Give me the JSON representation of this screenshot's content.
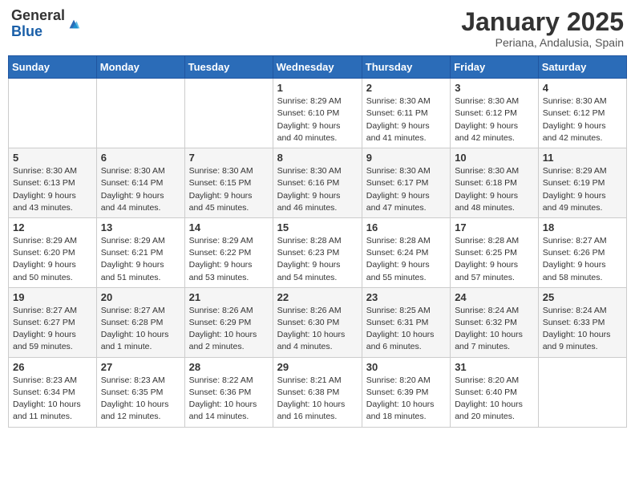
{
  "logo": {
    "general": "General",
    "blue": "Blue"
  },
  "title": "January 2025",
  "subtitle": "Periana, Andalusia, Spain",
  "days_of_week": [
    "Sunday",
    "Monday",
    "Tuesday",
    "Wednesday",
    "Thursday",
    "Friday",
    "Saturday"
  ],
  "weeks": [
    [
      {
        "day": "",
        "info": ""
      },
      {
        "day": "",
        "info": ""
      },
      {
        "day": "",
        "info": ""
      },
      {
        "day": "1",
        "info": "Sunrise: 8:29 AM\nSunset: 6:10 PM\nDaylight: 9 hours\nand 40 minutes."
      },
      {
        "day": "2",
        "info": "Sunrise: 8:30 AM\nSunset: 6:11 PM\nDaylight: 9 hours\nand 41 minutes."
      },
      {
        "day": "3",
        "info": "Sunrise: 8:30 AM\nSunset: 6:12 PM\nDaylight: 9 hours\nand 42 minutes."
      },
      {
        "day": "4",
        "info": "Sunrise: 8:30 AM\nSunset: 6:12 PM\nDaylight: 9 hours\nand 42 minutes."
      }
    ],
    [
      {
        "day": "5",
        "info": "Sunrise: 8:30 AM\nSunset: 6:13 PM\nDaylight: 9 hours\nand 43 minutes."
      },
      {
        "day": "6",
        "info": "Sunrise: 8:30 AM\nSunset: 6:14 PM\nDaylight: 9 hours\nand 44 minutes."
      },
      {
        "day": "7",
        "info": "Sunrise: 8:30 AM\nSunset: 6:15 PM\nDaylight: 9 hours\nand 45 minutes."
      },
      {
        "day": "8",
        "info": "Sunrise: 8:30 AM\nSunset: 6:16 PM\nDaylight: 9 hours\nand 46 minutes."
      },
      {
        "day": "9",
        "info": "Sunrise: 8:30 AM\nSunset: 6:17 PM\nDaylight: 9 hours\nand 47 minutes."
      },
      {
        "day": "10",
        "info": "Sunrise: 8:30 AM\nSunset: 6:18 PM\nDaylight: 9 hours\nand 48 minutes."
      },
      {
        "day": "11",
        "info": "Sunrise: 8:29 AM\nSunset: 6:19 PM\nDaylight: 9 hours\nand 49 minutes."
      }
    ],
    [
      {
        "day": "12",
        "info": "Sunrise: 8:29 AM\nSunset: 6:20 PM\nDaylight: 9 hours\nand 50 minutes."
      },
      {
        "day": "13",
        "info": "Sunrise: 8:29 AM\nSunset: 6:21 PM\nDaylight: 9 hours\nand 51 minutes."
      },
      {
        "day": "14",
        "info": "Sunrise: 8:29 AM\nSunset: 6:22 PM\nDaylight: 9 hours\nand 53 minutes."
      },
      {
        "day": "15",
        "info": "Sunrise: 8:28 AM\nSunset: 6:23 PM\nDaylight: 9 hours\nand 54 minutes."
      },
      {
        "day": "16",
        "info": "Sunrise: 8:28 AM\nSunset: 6:24 PM\nDaylight: 9 hours\nand 55 minutes."
      },
      {
        "day": "17",
        "info": "Sunrise: 8:28 AM\nSunset: 6:25 PM\nDaylight: 9 hours\nand 57 minutes."
      },
      {
        "day": "18",
        "info": "Sunrise: 8:27 AM\nSunset: 6:26 PM\nDaylight: 9 hours\nand 58 minutes."
      }
    ],
    [
      {
        "day": "19",
        "info": "Sunrise: 8:27 AM\nSunset: 6:27 PM\nDaylight: 9 hours\nand 59 minutes."
      },
      {
        "day": "20",
        "info": "Sunrise: 8:27 AM\nSunset: 6:28 PM\nDaylight: 10 hours\nand 1 minute."
      },
      {
        "day": "21",
        "info": "Sunrise: 8:26 AM\nSunset: 6:29 PM\nDaylight: 10 hours\nand 2 minutes."
      },
      {
        "day": "22",
        "info": "Sunrise: 8:26 AM\nSunset: 6:30 PM\nDaylight: 10 hours\nand 4 minutes."
      },
      {
        "day": "23",
        "info": "Sunrise: 8:25 AM\nSunset: 6:31 PM\nDaylight: 10 hours\nand 6 minutes."
      },
      {
        "day": "24",
        "info": "Sunrise: 8:24 AM\nSunset: 6:32 PM\nDaylight: 10 hours\nand 7 minutes."
      },
      {
        "day": "25",
        "info": "Sunrise: 8:24 AM\nSunset: 6:33 PM\nDaylight: 10 hours\nand 9 minutes."
      }
    ],
    [
      {
        "day": "26",
        "info": "Sunrise: 8:23 AM\nSunset: 6:34 PM\nDaylight: 10 hours\nand 11 minutes."
      },
      {
        "day": "27",
        "info": "Sunrise: 8:23 AM\nSunset: 6:35 PM\nDaylight: 10 hours\nand 12 minutes."
      },
      {
        "day": "28",
        "info": "Sunrise: 8:22 AM\nSunset: 6:36 PM\nDaylight: 10 hours\nand 14 minutes."
      },
      {
        "day": "29",
        "info": "Sunrise: 8:21 AM\nSunset: 6:38 PM\nDaylight: 10 hours\nand 16 minutes."
      },
      {
        "day": "30",
        "info": "Sunrise: 8:20 AM\nSunset: 6:39 PM\nDaylight: 10 hours\nand 18 minutes."
      },
      {
        "day": "31",
        "info": "Sunrise: 8:20 AM\nSunset: 6:40 PM\nDaylight: 10 hours\nand 20 minutes."
      },
      {
        "day": "",
        "info": ""
      }
    ]
  ]
}
